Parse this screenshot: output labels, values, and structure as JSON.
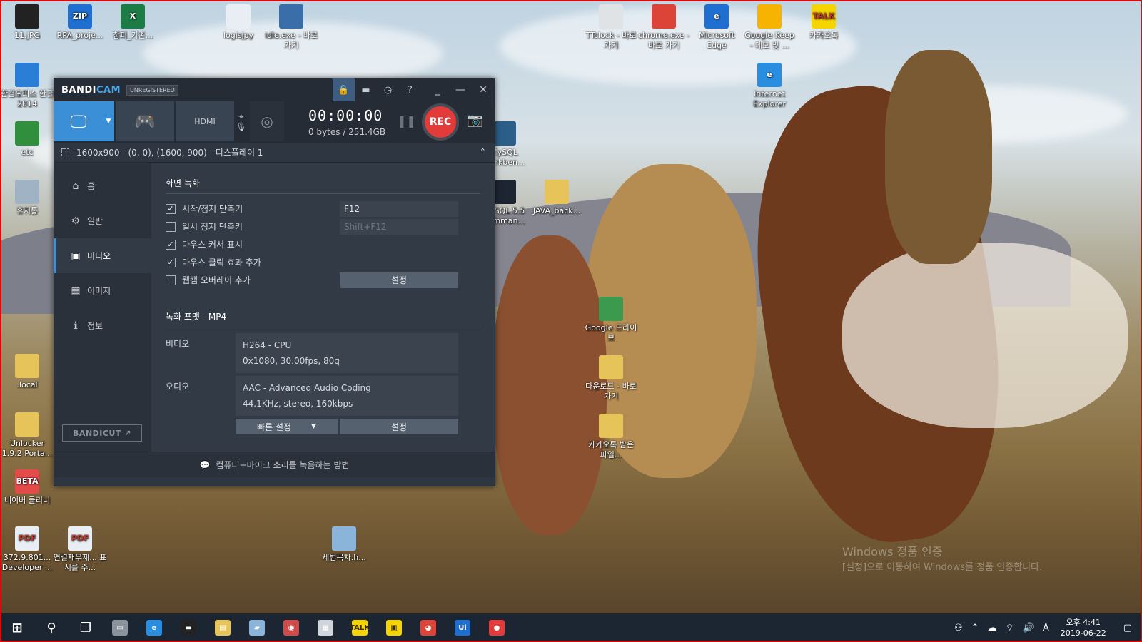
{
  "desktop": {
    "icons": [
      {
        "label": "11.JPG",
        "icon": "image-file-icon",
        "color": "#222"
      },
      {
        "label": "RPA_proje...",
        "icon": "zip-archive-icon",
        "color": "#1e6fd0",
        "badge": "ZIP"
      },
      {
        "label": "참피_기존...",
        "icon": "excel-icon",
        "color": "#1d7b45",
        "badge": "X"
      },
      {
        "label": "logisjpy",
        "icon": "text-file-icon",
        "color": "#e8eef4"
      },
      {
        "label": "idle.exe - 바로 가기",
        "icon": "python-idle-icon",
        "color": "#3a6ea8"
      },
      {
        "label": "TTclock - 바로 가기",
        "icon": "stopwatch-icon",
        "color": "#dfe3e6"
      },
      {
        "label": "chrome.exe - 바로 가기",
        "icon": "chrome-icon",
        "color": "#db4437"
      },
      {
        "label": "Microsoft Edge",
        "icon": "edge-icon",
        "color": "#1f6fd0",
        "badge": "e"
      },
      {
        "label": "Google Keep - 메모 및 ...",
        "icon": "google-keep-icon",
        "color": "#f6b400"
      },
      {
        "label": "카카오톡",
        "icon": "kakaotalk-icon",
        "color": "#f6d400",
        "badge": "TALK"
      },
      {
        "label": "한컴오피스 한글 2014",
        "icon": "hancom-icon",
        "color": "#2a7ed6"
      },
      {
        "label": "Internet Explorer",
        "icon": "internet-explorer-icon",
        "color": "#2a8ee0",
        "badge": "e"
      },
      {
        "label": "etc",
        "icon": "folder-icon",
        "color": "#2f8f3c"
      },
      {
        "label": "MySQL Workben...",
        "icon": "mysql-workbench-icon",
        "color": "#2b5f8a"
      },
      {
        "label": "휴지통",
        "icon": "recycle-bin-icon",
        "color": "#9fb3c4"
      },
      {
        "label": "MySQL 5.5 Comman...",
        "icon": "mysql-command-icon",
        "color": "#1d2533"
      },
      {
        "label": "JAVA_back...",
        "icon": "folder-icon",
        "color": "#e7c45a"
      },
      {
        "label": "Google 드라이브",
        "icon": "google-drive-icon",
        "color": "#3c9a4e"
      },
      {
        "label": ".local",
        "icon": "folder-icon",
        "color": "#e7c45a"
      },
      {
        "label": "다운로드 - 바로 가기",
        "icon": "downloads-folder-icon",
        "color": "#e7c45a"
      },
      {
        "label": "Unlocker 1.9.2 Porta...",
        "icon": "folder-icon",
        "color": "#e7c45a"
      },
      {
        "label": "카카오톡 받은 파일...",
        "icon": "folder-icon",
        "color": "#e7c45a"
      },
      {
        "label": "네이버 클리너",
        "icon": "naver-cleaner-icon",
        "color": "#e34a4a",
        "badge": "BETA"
      },
      {
        "label": "372.9.801... Developer ...",
        "icon": "pdf-icon",
        "color": "#e8eef4",
        "badge": "PDF"
      },
      {
        "label": "연결재무제... 표시를 주...",
        "icon": "pdf-icon",
        "color": "#e8eef4",
        "badge": "PDF"
      },
      {
        "label": "세법목차.h...",
        "icon": "hwp-file-icon",
        "color": "#8ab4da"
      }
    ],
    "watermark_title": "Windows 정품 인증",
    "watermark_sub": "[설정]으로 이동하여 Windows를 정품 인증합니다."
  },
  "bandicam": {
    "logo_a": "BANDI",
    "logo_b": "CAM",
    "unregistered": "UNREGISTERED",
    "title_icons": [
      "lock-icon",
      "folder-icon",
      "clock-icon",
      "help-icon"
    ],
    "title_glyphs": [
      "🔒",
      "▬",
      "◷",
      "?"
    ],
    "win_controls": [
      "_",
      "—",
      "✕"
    ],
    "mode_hdmi": "HDMI",
    "timer": "00:00:00",
    "size": "0 bytes / 251.4GB",
    "rec_label": "REC",
    "area_label": "1600x900 - (0, 0), (1600, 900) - 디스플레이 1",
    "sidebar": [
      {
        "label": "홈",
        "icon": "home-icon",
        "glyph": "⌂"
      },
      {
        "label": "일반",
        "icon": "gear-icon",
        "glyph": "⚙"
      },
      {
        "label": "비디오",
        "icon": "video-icon",
        "glyph": "▣"
      },
      {
        "label": "이미지",
        "icon": "image-icon",
        "glyph": "▦"
      },
      {
        "label": "정보",
        "icon": "info-icon",
        "glyph": "ℹ"
      }
    ],
    "bandicut_label": "BANDICUT ↗",
    "screen_recording": {
      "title": "화면 녹화",
      "options": [
        {
          "label": "시작/정지 단축키",
          "checked": true,
          "hotkey": "F12"
        },
        {
          "label": "일시 정지 단축키",
          "checked": false,
          "hotkey": "Shift+F12"
        },
        {
          "label": "마우스 커서 표시",
          "checked": true
        },
        {
          "label": "마우스 클릭 효과 추가",
          "checked": true
        },
        {
          "label": "웹캠 오버레이 추가",
          "checked": false
        }
      ],
      "settings_btn": "설정"
    },
    "format": {
      "title": "녹화 포맷 - MP4",
      "video_label": "비디오",
      "video_line1": "H264 - CPU",
      "video_line2": "0x1080, 30.00fps, 80q",
      "audio_label": "오디오",
      "audio_line1": "AAC - Advanced Audio Coding",
      "audio_line2": "44.1KHz, stereo, 160kbps",
      "quick_settings": "빠른 설정",
      "settings_btn": "설정"
    },
    "footer": "컴퓨터+마이크 소리를 녹음하는 방법"
  },
  "taskbar": {
    "items": [
      {
        "name": "start-button",
        "glyph": "⊞",
        "color": "#ffffff"
      },
      {
        "name": "search-button",
        "glyph": "⚲",
        "color": "#ffffff"
      },
      {
        "name": "task-view-button",
        "glyph": "❐",
        "color": "#ffffff"
      },
      {
        "name": "taskbar-app-1",
        "glyph": "▭",
        "color": "#8a939c"
      },
      {
        "name": "taskbar-edge",
        "glyph": "e",
        "color": "#2a8ee0"
      },
      {
        "name": "taskbar-cmd",
        "glyph": "▬",
        "color": "#222222"
      },
      {
        "name": "taskbar-explorer",
        "glyph": "▤",
        "color": "#e7c45a"
      },
      {
        "name": "taskbar-app-2",
        "glyph": "▰",
        "color": "#8ab4da"
      },
      {
        "name": "taskbar-paint",
        "glyph": "◉",
        "color": "#d04a4a"
      },
      {
        "name": "taskbar-calculator",
        "glyph": "▦",
        "color": "#cfd5db"
      },
      {
        "name": "taskbar-kakaotalk",
        "glyph": "TALK",
        "color": "#f6d400"
      },
      {
        "name": "taskbar-sticky-notes",
        "glyph": "▣",
        "color": "#f6d400"
      },
      {
        "name": "taskbar-chrome",
        "glyph": "◕",
        "color": "#db4437"
      },
      {
        "name": "taskbar-uipath",
        "glyph": "Ui",
        "color": "#1f6fd0"
      },
      {
        "name": "taskbar-bandicam",
        "glyph": "●",
        "color": "#e33a3a"
      }
    ],
    "tray": [
      "⚇",
      "⌃",
      "☁",
      "⌔",
      "🔊",
      "A"
    ],
    "time": "오후 4:41",
    "date": "2019-06-22",
    "notification": "▢"
  }
}
